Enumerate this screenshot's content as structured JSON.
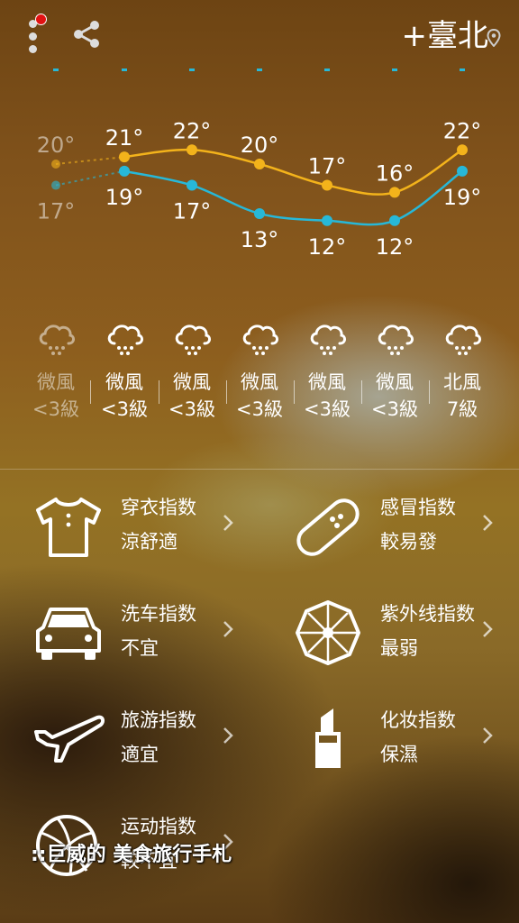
{
  "header": {
    "city": "+臺北"
  },
  "forecast": {
    "highs": [
      "20°",
      "21°",
      "22°",
      "20°",
      "17°",
      "16°",
      "22°"
    ],
    "lows": [
      "17°",
      "19°",
      "17°",
      "13°",
      "12°",
      "12°",
      "19°"
    ],
    "high_values": [
      20,
      21,
      22,
      20,
      17,
      16,
      22
    ],
    "low_values": [
      17,
      19,
      17,
      13,
      12,
      12,
      19
    ],
    "high_color": "#f3b31b",
    "low_color": "#27b8d8"
  },
  "wind": [
    {
      "dir": "微風",
      "lvl": "<3級"
    },
    {
      "dir": "微風",
      "lvl": "<3級"
    },
    {
      "dir": "微風",
      "lvl": "<3級"
    },
    {
      "dir": "微風",
      "lvl": "<3級"
    },
    {
      "dir": "微風",
      "lvl": "<3級"
    },
    {
      "dir": "微風",
      "lvl": "<3級"
    },
    {
      "dir": "北風",
      "lvl": "7級"
    }
  ],
  "indices": [
    {
      "name": "穿衣指数",
      "value": "涼舒適",
      "icon": "tshirt-icon"
    },
    {
      "name": "感冒指数",
      "value": "較易發",
      "icon": "bandage-icon"
    },
    {
      "name": "洗车指数",
      "value": "不宜",
      "icon": "car-icon"
    },
    {
      "name": "紫外线指数",
      "value": "最弱",
      "icon": "umbrella-icon"
    },
    {
      "name": "旅游指数",
      "value": "適宜",
      "icon": "airplane-icon"
    },
    {
      "name": "化妆指数",
      "value": "保濕",
      "icon": "lipstick-icon"
    },
    {
      "name": "运动指数",
      "value": "較不宜",
      "icon": "basketball-icon"
    }
  ],
  "watermark": "::巨威的 美食旅行手札"
}
